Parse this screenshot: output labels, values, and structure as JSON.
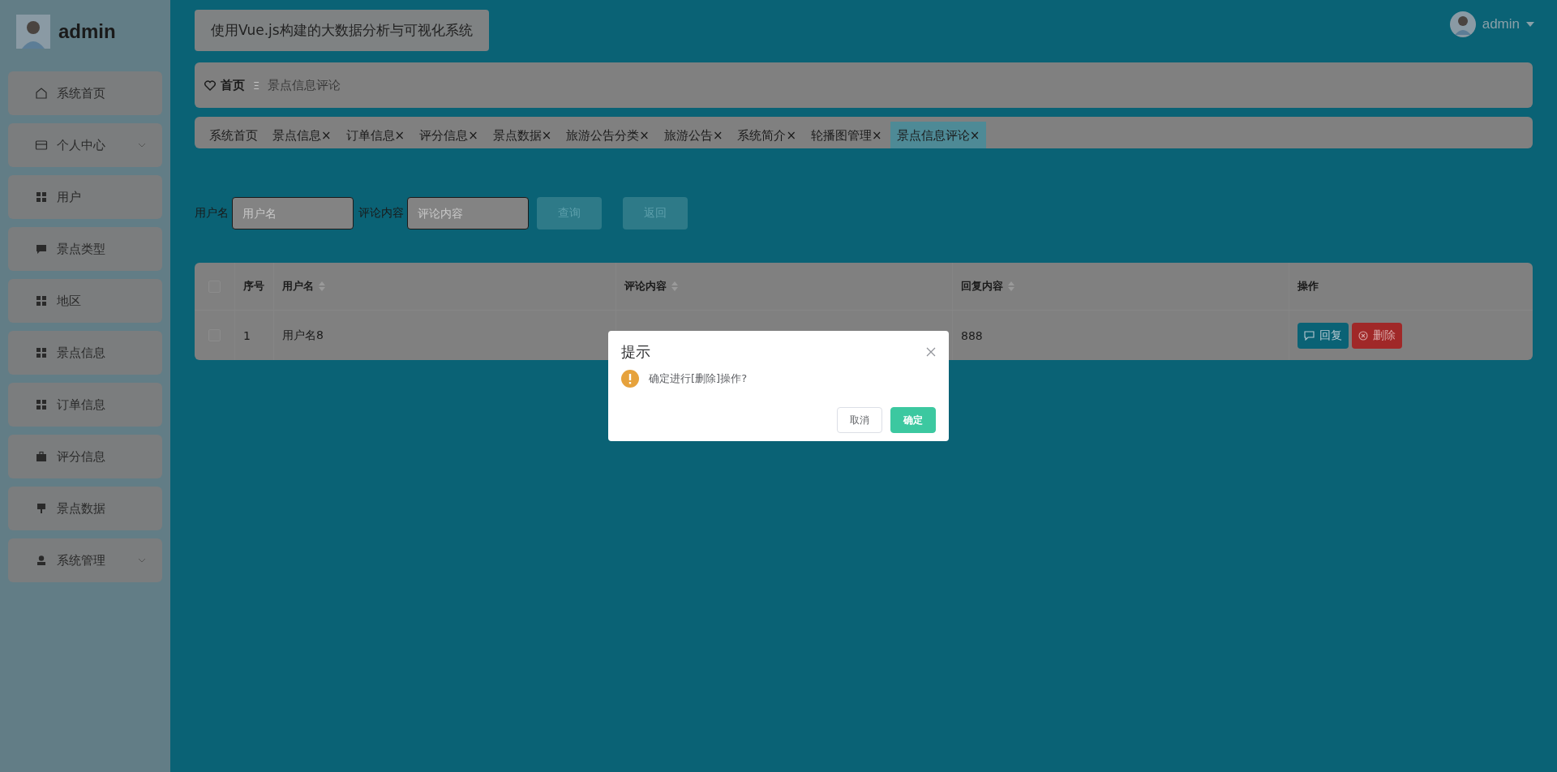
{
  "sidebar": {
    "user": "admin",
    "items": [
      {
        "label": "系统首页",
        "expandable": false
      },
      {
        "label": "个人中心",
        "expandable": true
      },
      {
        "label": "用户",
        "expandable": false
      },
      {
        "label": "景点类型",
        "expandable": false
      },
      {
        "label": "地区",
        "expandable": false
      },
      {
        "label": "景点信息",
        "expandable": false
      },
      {
        "label": "订单信息",
        "expandable": false
      },
      {
        "label": "评分信息",
        "expandable": false
      },
      {
        "label": "景点数据",
        "expandable": false
      },
      {
        "label": "系统管理",
        "expandable": true
      }
    ]
  },
  "header": {
    "title": "使用Vue.js构建的大数据分析与可视化系统",
    "user": "admin"
  },
  "breadcrumb": {
    "home": "首页",
    "separator": "Ξ",
    "current": "景点信息评论"
  },
  "tags": [
    {
      "label": "系统首页",
      "selected": false
    },
    {
      "label": "景点信息",
      "close": "×",
      "selected": false
    },
    {
      "label": "订单信息",
      "close": "×",
      "selected": false
    },
    {
      "label": "评分信息",
      "close": "×",
      "selected": false
    },
    {
      "label": "景点数据",
      "close": "×",
      "selected": false
    },
    {
      "label": "旅游公告分类",
      "close": "×",
      "selected": false
    },
    {
      "label": "旅游公告",
      "close": "×",
      "selected": false
    },
    {
      "label": "系统简介",
      "close": "×",
      "selected": false
    },
    {
      "label": "轮播图管理",
      "close": "×",
      "selected": false
    },
    {
      "label": "景点信息评论",
      "close": "×",
      "selected": true
    }
  ],
  "search": {
    "fields": [
      {
        "label": "用户名",
        "placeholder": "用户名"
      },
      {
        "label": "评论内容",
        "placeholder": "评论内容"
      }
    ],
    "buttons": [
      "查询",
      "返回"
    ]
  },
  "table": {
    "all_checked": false,
    "columns": [
      {
        "label": "序号",
        "sortable": false
      },
      {
        "label": "用户名",
        "sortable": true
      },
      {
        "label": "评论内容",
        "sortable": true
      },
      {
        "label": "回复内容",
        "sortable": true
      },
      {
        "label": "操作",
        "sortable": false
      }
    ],
    "rows": [
      {
        "checked": false,
        "cells": [
          "1",
          "用户名8",
          "",
          "888"
        ],
        "actions": [
          {
            "kind": "reply",
            "label": "回复"
          },
          {
            "kind": "delete",
            "label": "删除"
          }
        ]
      }
    ]
  },
  "dialog": {
    "title": "提示",
    "message": "确定进行[删除]操作?",
    "buttons": [
      {
        "kind": "cancel",
        "label": "取消"
      },
      {
        "kind": "confirm",
        "label": "确定"
      }
    ]
  }
}
